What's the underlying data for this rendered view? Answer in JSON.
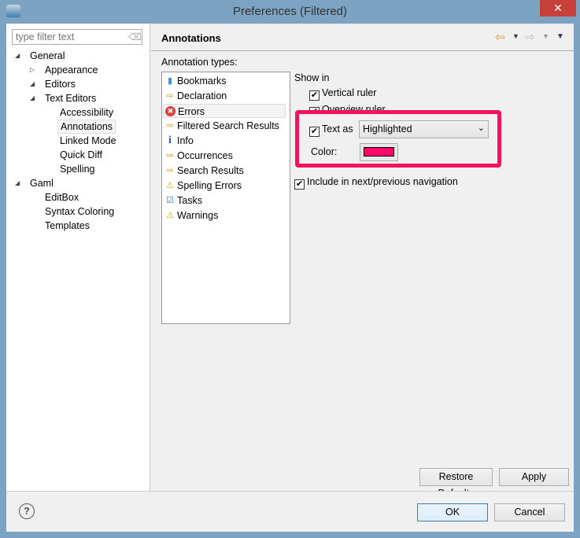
{
  "window": {
    "title": "Preferences (Filtered)",
    "close": "✕"
  },
  "filter": {
    "placeholder": "type filter text"
  },
  "tree": [
    {
      "label": "General",
      "twisty": "◢"
    },
    {
      "label": "Appearance",
      "twisty": "▷"
    },
    {
      "label": "Editors",
      "twisty": "◢"
    },
    {
      "label": "Text Editors",
      "twisty": "◢"
    },
    {
      "label": "Accessibility"
    },
    {
      "label": "Annotations",
      "selected": true
    },
    {
      "label": "Linked Mode"
    },
    {
      "label": "Quick Diff"
    },
    {
      "label": "Spelling"
    },
    {
      "label": "Gaml",
      "twisty": "◢"
    },
    {
      "label": "EditBox"
    },
    {
      "label": "Syntax Coloring"
    },
    {
      "label": "Templates"
    }
  ],
  "page": {
    "title": "Annotations",
    "types_label": "Annotation types:"
  },
  "annotation_types": [
    {
      "label": "Bookmarks",
      "icon": "bookmark-icon",
      "glyph": "▮",
      "color": "#4a8fd8"
    },
    {
      "label": "Declaration",
      "icon": "arrow-icon",
      "glyph": "⇨",
      "color": "#d89a20"
    },
    {
      "label": "Errors",
      "icon": "error-icon",
      "glyph": "✖",
      "color": "#d9423d",
      "selected": true
    },
    {
      "label": "Filtered Search Results",
      "icon": "arrow-icon",
      "glyph": "⇨",
      "color": "#d89a20"
    },
    {
      "label": "Info",
      "icon": "info-icon",
      "glyph": "i",
      "color": "#3a55a8"
    },
    {
      "label": "Occurrences",
      "icon": "arrow-icon",
      "glyph": "⇨",
      "color": "#d89a20"
    },
    {
      "label": "Search Results",
      "icon": "arrow-icon",
      "glyph": "⇨",
      "color": "#d89a20"
    },
    {
      "label": "Spelling Errors",
      "icon": "warning-icon",
      "glyph": "⚠",
      "color": "#e0a020"
    },
    {
      "label": "Tasks",
      "icon": "tasks-icon",
      "glyph": "☑",
      "color": "#3a7fd0"
    },
    {
      "label": "Warnings",
      "icon": "warning-icon",
      "glyph": "⚠",
      "color": "#e0a020"
    }
  ],
  "show_in": {
    "label": "Show in",
    "vertical_ruler": "Vertical ruler",
    "overview_ruler": "Overview ruler",
    "text_as": "Text as",
    "text_as_value": "Highlighted",
    "color_label": "Color:",
    "color": "#ff0a6c",
    "include_nav": "Include in next/previous navigation",
    "check": "✔"
  },
  "highlight_color": "#f2125f",
  "buttons": {
    "restore": "Restore Defaults",
    "apply": "Apply",
    "ok": "OK",
    "cancel": "Cancel",
    "help": "?"
  }
}
